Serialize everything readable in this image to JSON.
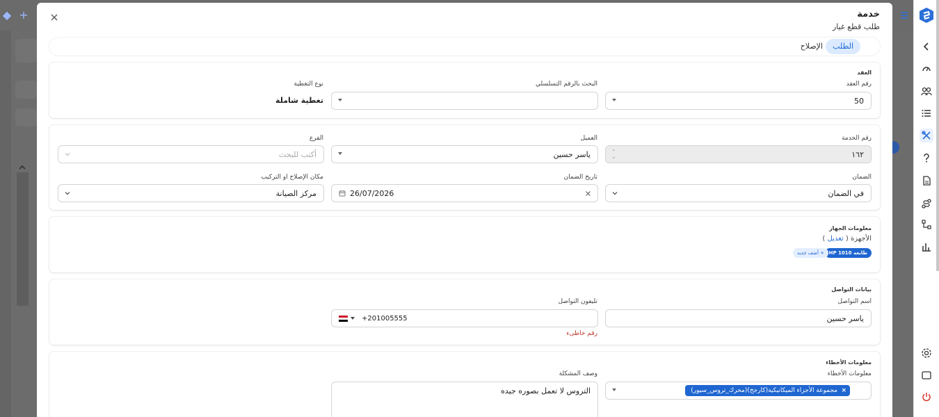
{
  "modal": {
    "title": "خدمة",
    "subtitle": "طلب قطع غيار",
    "tabs": [
      {
        "label": "الطلب",
        "active": true
      },
      {
        "label": "الإصلاح",
        "active": false
      }
    ]
  },
  "contract": {
    "section_title": "العقد",
    "contract_no_label": "رقم العقد",
    "contract_no_value": "50",
    "serial_search_label": "البحث بالرقم التسلسلي",
    "serial_search_value": "",
    "coverage_label": "نوع التغطية",
    "coverage_value": "تغطية شاملة"
  },
  "service": {
    "service_no_label": "رقم الخدمة",
    "service_no_value": "١٦٢",
    "customer_label": "العميل",
    "customer_value": "ياسر حسين",
    "branch_label": "الفرع",
    "branch_placeholder": "أكتب للبحث",
    "warranty_label": "الضمان",
    "warranty_value": "في الضمان",
    "warranty_date_label": "تاريخ الضمان",
    "warranty_date_value": "26/07/2026",
    "repair_place_label": "مكان الإصلاح او التركيب",
    "repair_place_value": "مركز الصيانة"
  },
  "device": {
    "section_title": "معلومات الجهاز",
    "devices_label": "الأجهزة (",
    "edit_link": "تعديل",
    "devices_label_end": ")",
    "device_chip": "طابعه HP 1010",
    "add_new_chip": "+ أضف جديد"
  },
  "contact": {
    "section_title": "بيانات التواصل",
    "contact_name_label": "اسم التواصل",
    "contact_name_value": "ياسر حسين",
    "contact_phone_label": "تليفون التواصل",
    "contact_phone_value": "+201005555",
    "phone_error": "رقم خاطىء"
  },
  "faults": {
    "section_title": "معلومات الأخطاء",
    "faults_label": "معلومات الأخطاء",
    "fault_tag": "مجموعة الأجزاء الميكانيكية(كارجح)(محرك_تروس_سيور)",
    "problem_desc_label": "وصف المشكلة",
    "problem_desc_value": "التروس لا تعمل بصوره جيده"
  },
  "colors": {
    "accent": "#1f66d1",
    "accent_light": "#dbeaff",
    "error": "#c0392b"
  },
  "icons": {
    "sidebar": [
      "chevron-left-icon",
      "dashboard-icon",
      "users-icon",
      "list-icon",
      "tools-icon",
      "question-icon",
      "document-icon",
      "route-icon",
      "hierarchy-icon",
      "bar-chart-icon",
      "settings-icon",
      "window-icon",
      "power-icon"
    ]
  }
}
